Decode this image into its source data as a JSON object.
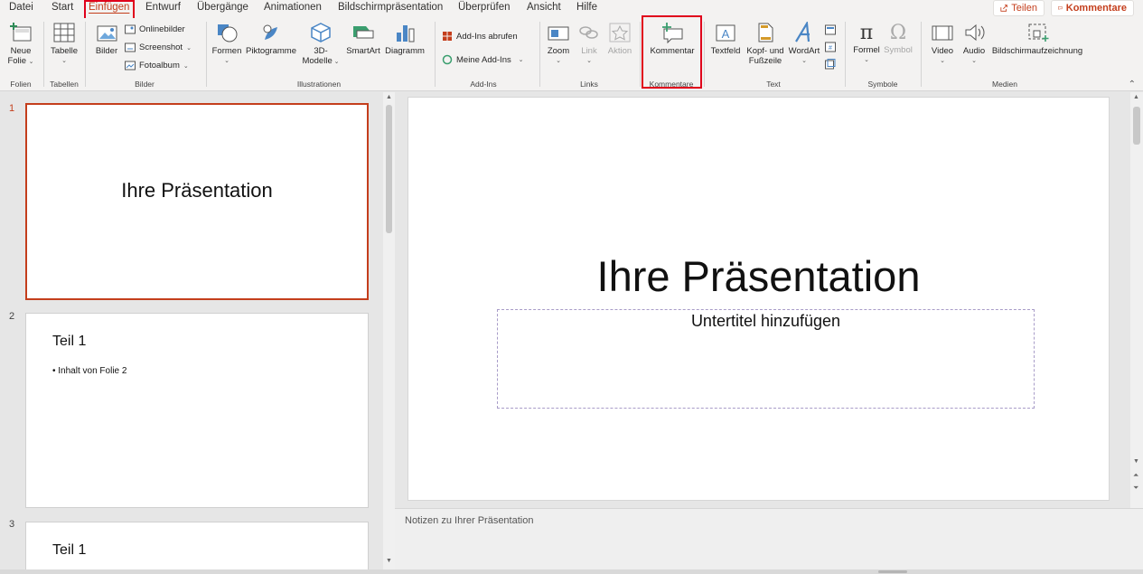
{
  "menu": {
    "tabs": [
      "Datei",
      "Start",
      "Einfügen",
      "Entwurf",
      "Übergänge",
      "Animationen",
      "Bildschirmpräsentation",
      "Überprüfen",
      "Ansicht",
      "Hilfe"
    ],
    "active_tab": "Einfügen",
    "share_label": "Teilen",
    "comments_label": "Kommentare"
  },
  "ribbon": {
    "folien": {
      "label": "Folien",
      "new_slide": "Neue",
      "new_slide_2": "Folie"
    },
    "tabellen": {
      "label": "Tabellen",
      "table": "Tabelle"
    },
    "bilder": {
      "label": "Bilder",
      "pictures": "Bilder",
      "online": "Onlinebilder",
      "screenshot": "Screenshot",
      "album": "Fotoalbum"
    },
    "illustrationen": {
      "label": "Illustrationen",
      "shapes": "Formen",
      "icons": "Piktogramme",
      "models": "3D-",
      "models_2": "Modelle",
      "smartart": "SmartArt",
      "chart": "Diagramm"
    },
    "addins": {
      "label": "Add-Ins",
      "get": "Add-Ins abrufen",
      "my": "Meine Add-Ins"
    },
    "links": {
      "label": "Links",
      "zoom": "Zoom",
      "link": "Link",
      "action": "Aktion"
    },
    "kommentare": {
      "label": "Kommentare",
      "comment": "Kommentar"
    },
    "text": {
      "label": "Text",
      "textbox": "Textfeld",
      "header": "Kopf- und",
      "header_2": "Fußzeile",
      "wordart": "WordArt"
    },
    "symbole": {
      "label": "Symbole",
      "equation": "Formel",
      "symbol": "Symbol"
    },
    "medien": {
      "label": "Medien",
      "video": "Video",
      "audio": "Audio",
      "recording": "Bildschirmaufzeichnung"
    }
  },
  "slides": [
    {
      "number": "1",
      "title": "Ihre Präsentation"
    },
    {
      "number": "2",
      "heading": "Teil 1",
      "bullet": "• Inhalt von Folie 2"
    },
    {
      "number": "3",
      "heading": "Teil 1"
    }
  ],
  "editor": {
    "title": "Ihre Präsentation",
    "subtitle": "Untertitel hinzufügen"
  },
  "notes": {
    "placeholder": "Notizen zu Ihrer Präsentation"
  },
  "colors": {
    "accent": "#c43e1c",
    "highlight": "#e0001b"
  }
}
